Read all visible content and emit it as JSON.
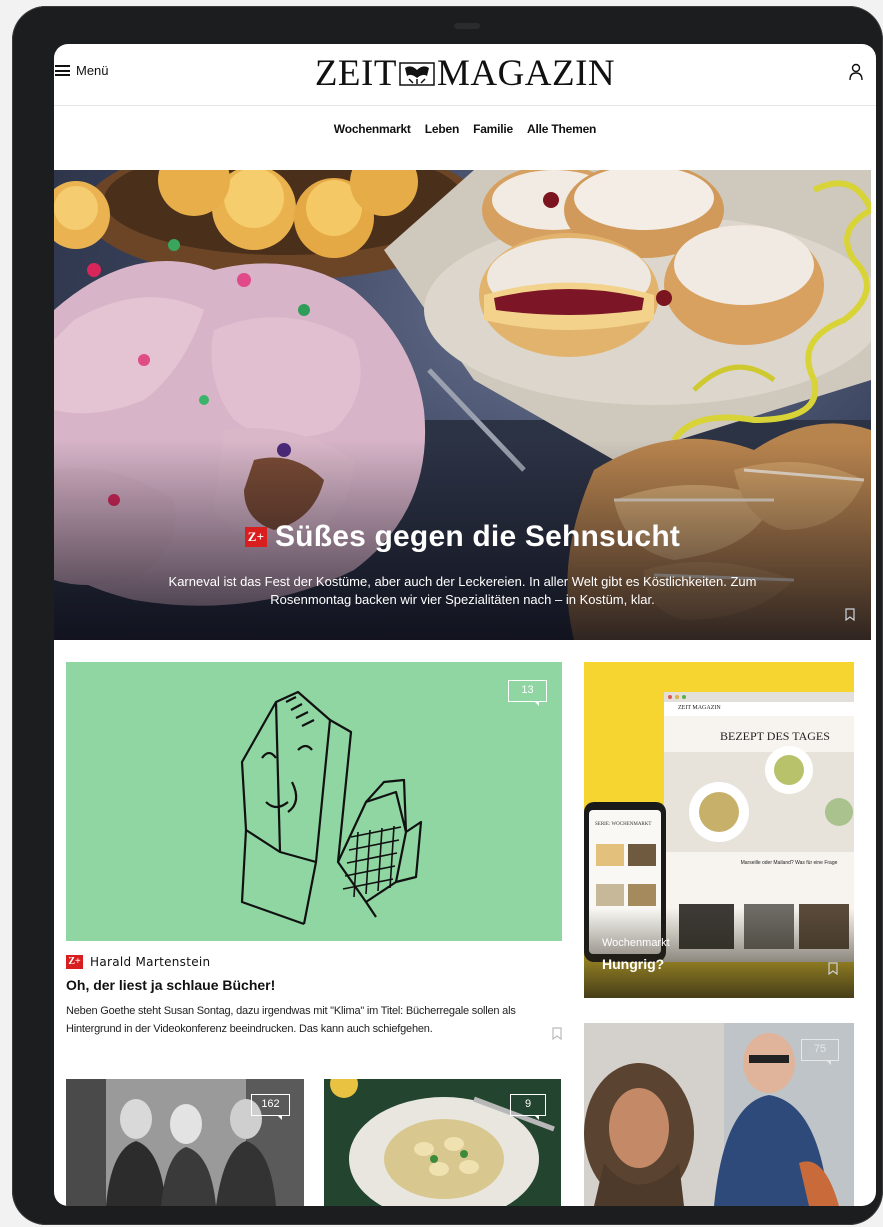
{
  "header": {
    "menu_label": "Menü",
    "logo_left": "ZEIT",
    "logo_right": "MAGAZIN"
  },
  "nav": [
    {
      "label": "Wochenmarkt"
    },
    {
      "label": "Leben"
    },
    {
      "label": "Familie"
    },
    {
      "label": "Alle Themen"
    }
  ],
  "hero": {
    "badge": "Z+",
    "title": "Süßes gegen die Sehnsucht",
    "subtitle": "Karneval ist das Fest der Kostüme, aber auch der Leckereien. In aller Welt gibt es Köstlichkeiten. Zum Rosenmontag backen wir vier Spezialitäten nach – in Kostüm, klar."
  },
  "main_teaser": {
    "comments": "13",
    "badge": "Z+",
    "author": "Harald Martenstein",
    "title": "Oh, der liest ja schlaue Bücher!",
    "text": "Neben Goethe steht Susan Sontag, dazu irgendwas mit \"Klima\" im Titel: Bücherregale sollen als Hintergrund in der Videokonferenz beeindrucken. Das kann auch schiefgehen."
  },
  "side_promo": {
    "screen_logo": "ZEIT MAGAZIN",
    "screen_heading": "BEZEPT DES TAGES",
    "screen_article": "Marseille oder Mailand? Was für eine Frage",
    "phone_heading": "SERIE: WOCHENMARKT",
    "kicker": "Wochenmarkt",
    "title": "Hungrig?"
  },
  "bottom_teasers": [
    {
      "comments": "162"
    },
    {
      "comments": "9"
    },
    {
      "comments": "75"
    }
  ],
  "colors": {
    "zplus_red": "#d81e1e",
    "illustration_green": "#8fd6a2",
    "promo_yellow": "#f6d530"
  },
  "icons": {
    "menu": "hamburger-icon",
    "account": "user-icon",
    "bookmark": "bookmark-icon",
    "comments": "comment-bubble-icon"
  }
}
